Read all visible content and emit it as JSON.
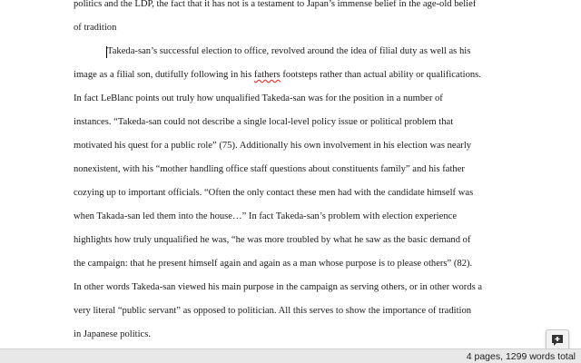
{
  "document": {
    "lines": [
      "politics and the LDP, the fact that it has not is a testament to Japan’s immense belief in the age-old belief",
      "of tradition",
      "Takeda-san’s successful election to office, revolved around the idea of filial duty as well as his",
      "image as a filial son, dutifully following in his fathers footsteps rather than actual ability or qualifications.",
      "In fact LeBlanc points out truly how unqualified Takeda-san was for the position in a number of",
      "instances.  “Takeda-san could not describe a single local-level policy issue or political problem that",
      "motivated his quest for a public role” (75).  Additionally his own involvement in his election was nearly",
      "nonexistent, with his “mother handling office staff questions about constituents family” and his father",
      "cozying up to important officials.  “Often the only contact these men had with the candidate himself was",
      "when Takada-san led them into the house…” In fact Takeda-san’s  problem with election experience",
      "highlights how truly unqualified he was, “he was more troubled by what he saw as the basic demand of",
      "the campaign: that he present himself again and again as a man whose purpose is to please others” (82).",
      "In other words Takeda-san viewed his main purpose in the campaign as serving others, or in other words a",
      "very literal “public servant” as opposed to politician.  All this serves to show the importance of tradition",
      "in Japanese politics."
    ],
    "line3_pre": "image as a filial son, dutifully following in his ",
    "line3_misspelled": "fathers",
    "line3_post": " footsteps rather than actual ability or qualifications."
  },
  "statusbar": {
    "text": "4 pages, 1299 words total"
  },
  "icons": {
    "floating_button": "comment-plus-icon"
  }
}
